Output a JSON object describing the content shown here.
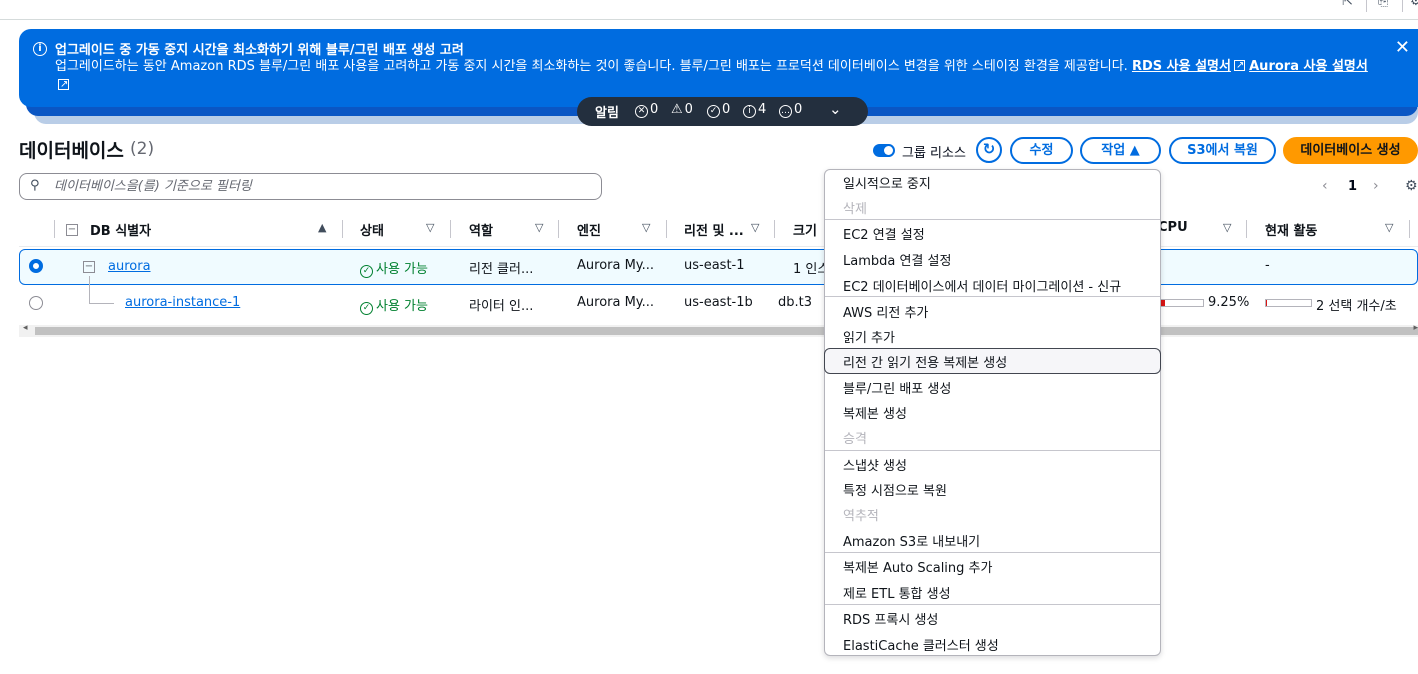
{
  "flash": {
    "title": "업그레이드 중 가동 중지 시간을 최소화하기 위해 블루/그린 배포 생성 고려",
    "body": "업그레이드하는 동안 Amazon RDS 블루/그린 배포 사용을 고려하고 가동 중지 시간을 최소화하는 것이 좋습니다. 블루/그린 배포는 프로덕션 데이터베이스 변경을 위한 스테이징 환경을 제공합니다. ",
    "link1": "RDS 사용 설명서",
    "link2": "Aurora 사용 설명서",
    "close": "✕"
  },
  "notifications": {
    "label": "알림",
    "error": "0",
    "warning": "0",
    "success": "0",
    "info": "4",
    "pending": "0"
  },
  "header": {
    "title": "데이터베이스",
    "count": "(2)",
    "group_toggle_label": "그룹 리소스",
    "modify": "수정",
    "actions": "작업 ▲",
    "restore_s3": "S3에서 복원",
    "create": "데이터베이스 생성"
  },
  "search": {
    "placeholder": "데이터베이스을(를) 기준으로 필터링"
  },
  "pagination": {
    "page": "1"
  },
  "table": {
    "columns": [
      "DB 식별자",
      "상태",
      "역할",
      "엔진",
      "리전 및 ...",
      "크기",
      "CPU",
      "현재 활동"
    ],
    "rows": [
      {
        "id": "aurora",
        "status": "사용 가능",
        "role": "리전 클러...",
        "engine": "Aurora My...",
        "region": "us-east-1",
        "size": "1 인스",
        "cpu": "",
        "activity": "-"
      },
      {
        "id": "aurora-instance-1",
        "status": "사용 가능",
        "role": "라이터 인...",
        "engine": "Aurora My...",
        "region": "us-east-1b",
        "size": "db.t3",
        "cpu": "9.25%",
        "cpu_fraction": 0.0925,
        "activity": "2 선택 개수/초",
        "activity_fraction": 0.02
      }
    ]
  },
  "menu": {
    "items": [
      {
        "label": "일시적으로 중지",
        "disabled": false
      },
      {
        "label": "삭제",
        "disabled": true
      },
      {
        "label": "EC2 연결 설정",
        "disabled": false
      },
      {
        "label": "Lambda 연결 설정",
        "disabled": false
      },
      {
        "label": "EC2 데이터베이스에서 데이터 마이그레이션 - 신규",
        "disabled": false
      },
      {
        "label": "AWS 리전 추가",
        "disabled": false
      },
      {
        "label": "읽기 추가",
        "disabled": false
      },
      {
        "label": "리전 간 읽기 전용 복제본 생성",
        "disabled": false,
        "highlighted": true
      },
      {
        "label": "블루/그린 배포 생성",
        "disabled": false
      },
      {
        "label": "복제본 생성",
        "disabled": false
      },
      {
        "label": "승격",
        "disabled": true
      },
      {
        "label": "스냅샷 생성",
        "disabled": false
      },
      {
        "label": "특정 시점으로 복원",
        "disabled": false
      },
      {
        "label": "역추적",
        "disabled": true
      },
      {
        "label": "Amazon S3로 내보내기",
        "disabled": false
      },
      {
        "label": "복제본 Auto Scaling 추가",
        "disabled": false
      },
      {
        "label": "제로 ETL 통합 생성",
        "disabled": false
      },
      {
        "label": "RDS 프록시 생성",
        "disabled": false
      },
      {
        "label": "ElastiCache 클러스터 생성",
        "disabled": false
      }
    ]
  },
  "colors": {
    "accent": "#006ce0",
    "primary_button": "#ff9900",
    "success": "#00802f",
    "flash": "#006ce0"
  }
}
